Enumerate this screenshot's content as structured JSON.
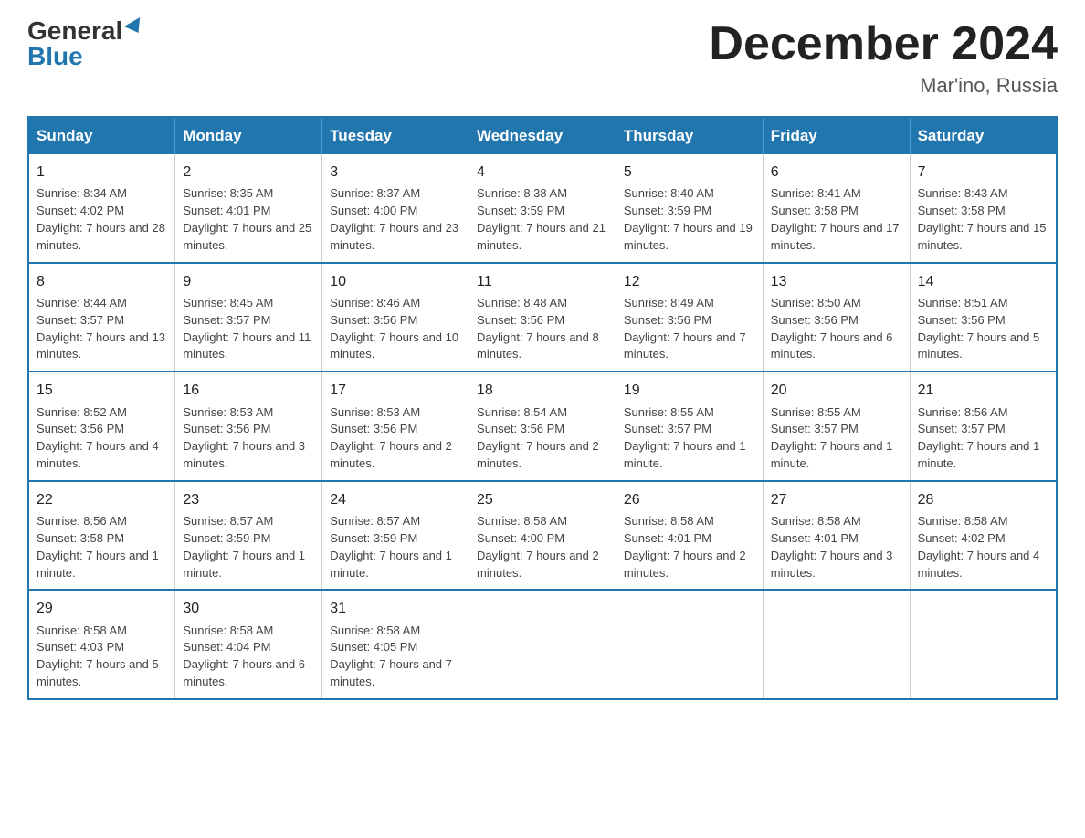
{
  "header": {
    "logo_general": "General",
    "logo_blue": "Blue",
    "month_title": "December 2024",
    "location": "Mar'ino, Russia"
  },
  "calendar": {
    "days_of_week": [
      "Sunday",
      "Monday",
      "Tuesday",
      "Wednesday",
      "Thursday",
      "Friday",
      "Saturday"
    ],
    "weeks": [
      [
        {
          "day": "1",
          "sunrise": "Sunrise: 8:34 AM",
          "sunset": "Sunset: 4:02 PM",
          "daylight": "Daylight: 7 hours and 28 minutes."
        },
        {
          "day": "2",
          "sunrise": "Sunrise: 8:35 AM",
          "sunset": "Sunset: 4:01 PM",
          "daylight": "Daylight: 7 hours and 25 minutes."
        },
        {
          "day": "3",
          "sunrise": "Sunrise: 8:37 AM",
          "sunset": "Sunset: 4:00 PM",
          "daylight": "Daylight: 7 hours and 23 minutes."
        },
        {
          "day": "4",
          "sunrise": "Sunrise: 8:38 AM",
          "sunset": "Sunset: 3:59 PM",
          "daylight": "Daylight: 7 hours and 21 minutes."
        },
        {
          "day": "5",
          "sunrise": "Sunrise: 8:40 AM",
          "sunset": "Sunset: 3:59 PM",
          "daylight": "Daylight: 7 hours and 19 minutes."
        },
        {
          "day": "6",
          "sunrise": "Sunrise: 8:41 AM",
          "sunset": "Sunset: 3:58 PM",
          "daylight": "Daylight: 7 hours and 17 minutes."
        },
        {
          "day": "7",
          "sunrise": "Sunrise: 8:43 AM",
          "sunset": "Sunset: 3:58 PM",
          "daylight": "Daylight: 7 hours and 15 minutes."
        }
      ],
      [
        {
          "day": "8",
          "sunrise": "Sunrise: 8:44 AM",
          "sunset": "Sunset: 3:57 PM",
          "daylight": "Daylight: 7 hours and 13 minutes."
        },
        {
          "day": "9",
          "sunrise": "Sunrise: 8:45 AM",
          "sunset": "Sunset: 3:57 PM",
          "daylight": "Daylight: 7 hours and 11 minutes."
        },
        {
          "day": "10",
          "sunrise": "Sunrise: 8:46 AM",
          "sunset": "Sunset: 3:56 PM",
          "daylight": "Daylight: 7 hours and 10 minutes."
        },
        {
          "day": "11",
          "sunrise": "Sunrise: 8:48 AM",
          "sunset": "Sunset: 3:56 PM",
          "daylight": "Daylight: 7 hours and 8 minutes."
        },
        {
          "day": "12",
          "sunrise": "Sunrise: 8:49 AM",
          "sunset": "Sunset: 3:56 PM",
          "daylight": "Daylight: 7 hours and 7 minutes."
        },
        {
          "day": "13",
          "sunrise": "Sunrise: 8:50 AM",
          "sunset": "Sunset: 3:56 PM",
          "daylight": "Daylight: 7 hours and 6 minutes."
        },
        {
          "day": "14",
          "sunrise": "Sunrise: 8:51 AM",
          "sunset": "Sunset: 3:56 PM",
          "daylight": "Daylight: 7 hours and 5 minutes."
        }
      ],
      [
        {
          "day": "15",
          "sunrise": "Sunrise: 8:52 AM",
          "sunset": "Sunset: 3:56 PM",
          "daylight": "Daylight: 7 hours and 4 minutes."
        },
        {
          "day": "16",
          "sunrise": "Sunrise: 8:53 AM",
          "sunset": "Sunset: 3:56 PM",
          "daylight": "Daylight: 7 hours and 3 minutes."
        },
        {
          "day": "17",
          "sunrise": "Sunrise: 8:53 AM",
          "sunset": "Sunset: 3:56 PM",
          "daylight": "Daylight: 7 hours and 2 minutes."
        },
        {
          "day": "18",
          "sunrise": "Sunrise: 8:54 AM",
          "sunset": "Sunset: 3:56 PM",
          "daylight": "Daylight: 7 hours and 2 minutes."
        },
        {
          "day": "19",
          "sunrise": "Sunrise: 8:55 AM",
          "sunset": "Sunset: 3:57 PM",
          "daylight": "Daylight: 7 hours and 1 minute."
        },
        {
          "day": "20",
          "sunrise": "Sunrise: 8:55 AM",
          "sunset": "Sunset: 3:57 PM",
          "daylight": "Daylight: 7 hours and 1 minute."
        },
        {
          "day": "21",
          "sunrise": "Sunrise: 8:56 AM",
          "sunset": "Sunset: 3:57 PM",
          "daylight": "Daylight: 7 hours and 1 minute."
        }
      ],
      [
        {
          "day": "22",
          "sunrise": "Sunrise: 8:56 AM",
          "sunset": "Sunset: 3:58 PM",
          "daylight": "Daylight: 7 hours and 1 minute."
        },
        {
          "day": "23",
          "sunrise": "Sunrise: 8:57 AM",
          "sunset": "Sunset: 3:59 PM",
          "daylight": "Daylight: 7 hours and 1 minute."
        },
        {
          "day": "24",
          "sunrise": "Sunrise: 8:57 AM",
          "sunset": "Sunset: 3:59 PM",
          "daylight": "Daylight: 7 hours and 1 minute."
        },
        {
          "day": "25",
          "sunrise": "Sunrise: 8:58 AM",
          "sunset": "Sunset: 4:00 PM",
          "daylight": "Daylight: 7 hours and 2 minutes."
        },
        {
          "day": "26",
          "sunrise": "Sunrise: 8:58 AM",
          "sunset": "Sunset: 4:01 PM",
          "daylight": "Daylight: 7 hours and 2 minutes."
        },
        {
          "day": "27",
          "sunrise": "Sunrise: 8:58 AM",
          "sunset": "Sunset: 4:01 PM",
          "daylight": "Daylight: 7 hours and 3 minutes."
        },
        {
          "day": "28",
          "sunrise": "Sunrise: 8:58 AM",
          "sunset": "Sunset: 4:02 PM",
          "daylight": "Daylight: 7 hours and 4 minutes."
        }
      ],
      [
        {
          "day": "29",
          "sunrise": "Sunrise: 8:58 AM",
          "sunset": "Sunset: 4:03 PM",
          "daylight": "Daylight: 7 hours and 5 minutes."
        },
        {
          "day": "30",
          "sunrise": "Sunrise: 8:58 AM",
          "sunset": "Sunset: 4:04 PM",
          "daylight": "Daylight: 7 hours and 6 minutes."
        },
        {
          "day": "31",
          "sunrise": "Sunrise: 8:58 AM",
          "sunset": "Sunset: 4:05 PM",
          "daylight": "Daylight: 7 hours and 7 minutes."
        },
        null,
        null,
        null,
        null
      ]
    ]
  }
}
